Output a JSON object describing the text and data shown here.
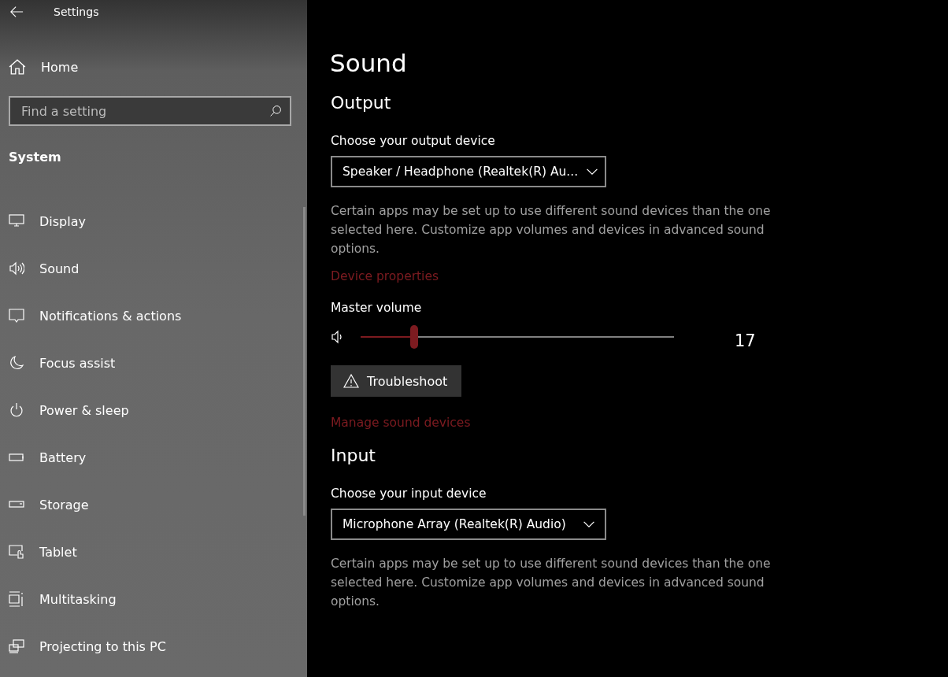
{
  "window": {
    "title": "Settings"
  },
  "sidebar": {
    "home": "Home",
    "search": {
      "placeholder": "Find a setting"
    },
    "section": "System",
    "items": [
      {
        "label": "Display"
      },
      {
        "label": "Sound"
      },
      {
        "label": "Notifications & actions"
      },
      {
        "label": "Focus assist"
      },
      {
        "label": "Power & sleep"
      },
      {
        "label": "Battery"
      },
      {
        "label": "Storage"
      },
      {
        "label": "Tablet"
      },
      {
        "label": "Multitasking"
      },
      {
        "label": "Projecting to this PC"
      }
    ]
  },
  "page": {
    "title": "Sound",
    "output": {
      "heading": "Output",
      "device_label": "Choose your output device",
      "device": "Speaker / Headphone (Realtek(R) Au...",
      "note": "Certain apps may be set up to use different sound devices than the one selected here. Customize app volumes and devices in advanced sound options.",
      "link": "Device properties",
      "volume_label": "Master volume",
      "volume": {
        "level": 0.17,
        "reading": "17"
      },
      "troubleshoot": "Troubleshoot",
      "manage_link": "Manage sound devices"
    },
    "input": {
      "heading": "Input",
      "device_label": "Choose your input device",
      "device": "Microphone Array (Realtek(R) Audio)",
      "note": "Certain apps may be set up to use different sound devices than the one selected here. Customize app volumes and devices in advanced sound options."
    }
  }
}
